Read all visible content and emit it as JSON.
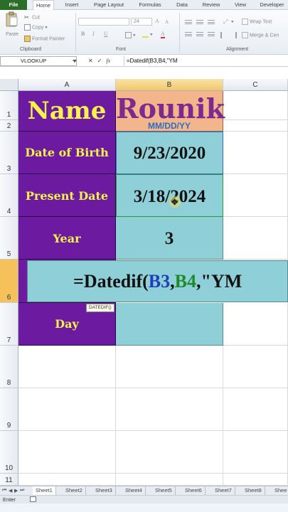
{
  "tabs": [
    "File",
    "Home",
    "Insert",
    "Page Layout",
    "Formulas",
    "Data",
    "Review",
    "View",
    "Developer"
  ],
  "ribbon": {
    "paste_label": "Paste",
    "cut_label": "Cut",
    "copy_label": "Copy",
    "format_painter_label": "Format Painter",
    "clipboard_group": "Clipboard",
    "font_size": "24",
    "font_group": "Font",
    "wrap_text_label": "Wrap Text",
    "merge_label": "Merge & Cen",
    "alignment_group": "Alignment"
  },
  "formula_bar": {
    "name_box": "VLOOKUP",
    "cancel": "✕",
    "enter": "✓",
    "fx": "fx",
    "formula": "=Datedif(B3,B4,\"YM"
  },
  "columns": [
    "A",
    "B",
    "C"
  ],
  "rows": [
    "1",
    "2",
    "3",
    "4",
    "5",
    "6",
    "7",
    "8",
    "9",
    "10",
    "11"
  ],
  "cells": {
    "a1": "Name",
    "b1": "Rounik",
    "b2": "MM/DD/YY",
    "a3": "Date of Birth",
    "b3": "9/23/2020",
    "a4": "Present Date",
    "b4": "3/18/2024",
    "a5": "Year",
    "b5": "3",
    "a7": "Day"
  },
  "edit": {
    "prefix": "=Datedif(",
    "ref1": "B3",
    "comma1": ",",
    "ref2": "B4",
    "suffix": ",\"YM"
  },
  "tooltip": "DATEDIF()",
  "sheets": [
    "Sheet1",
    "Sheet2",
    "Sheet3",
    "Sheet4",
    "Sheet5",
    "Sheet6",
    "Sheet7",
    "Sheet8",
    "Shee"
  ],
  "status": "Enter",
  "colors": {
    "purple": "#6c1ba0",
    "teal": "#8fd0d8",
    "yellow": "#f8f34a",
    "salmon": "#f3b68c",
    "name_purple": "#7d2a8e",
    "mmdd_blue": "#2a6fc4",
    "row_select": "#f4c15a"
  }
}
